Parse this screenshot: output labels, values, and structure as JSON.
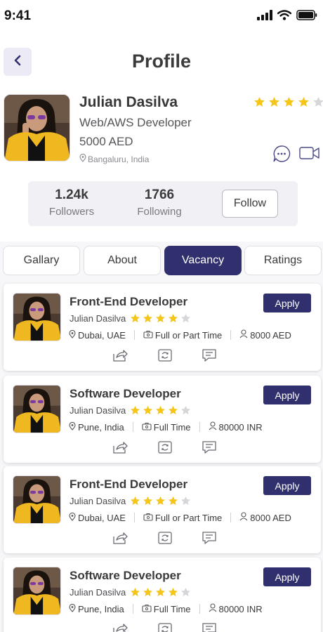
{
  "status_bar": {
    "time": "9:41",
    "icons": [
      "signal-icon",
      "wifi-icon",
      "battery-icon"
    ]
  },
  "header": {
    "title": "Profile",
    "back_icon": "chevron-left-icon"
  },
  "profile": {
    "name": "Julian Dasilva",
    "role": "Web/AWS Developer",
    "salary": "5000 AED",
    "location": "Bangaluru, India",
    "rating": 4,
    "rating_max": 5,
    "actions": [
      "chat-icon",
      "video-call-icon"
    ]
  },
  "stats": {
    "followers_count": "1.24k",
    "followers_label": "Followers",
    "following_count": "1766",
    "following_label": "Following",
    "follow_button": "Follow"
  },
  "tabs": [
    {
      "label": "Gallary",
      "active": false
    },
    {
      "label": "About",
      "active": false
    },
    {
      "label": "Vacancy",
      "active": true
    },
    {
      "label": "Ratings",
      "active": false
    }
  ],
  "vacancies": [
    {
      "title": "Front-End Developer",
      "company": "Julian Dasilva",
      "rating": 4,
      "location": "Dubai, UAE",
      "job_type": "Full or Part Time",
      "salary": "8000 AED",
      "apply": "Apply"
    },
    {
      "title": "Software Developer",
      "company": "Julian Dasilva",
      "rating": 4,
      "location": "Pune, India",
      "job_type": "Full Time",
      "salary": "80000 INR",
      "apply": "Apply"
    },
    {
      "title": "Front-End Developer",
      "company": "Julian Dasilva",
      "rating": 4,
      "location": "Dubai, UAE",
      "job_type": "Full or Part Time",
      "salary": "8000 AED",
      "apply": "Apply"
    },
    {
      "title": "Software Developer",
      "company": "Julian Dasilva",
      "rating": 4,
      "location": "Pune, India",
      "job_type": "Full Time",
      "salary": "80000 INR",
      "apply": "Apply"
    }
  ],
  "colors": {
    "primary": "#30306e",
    "star": "#f5c518",
    "star_empty": "#d6d6da",
    "back_bg": "#ecebf5"
  }
}
